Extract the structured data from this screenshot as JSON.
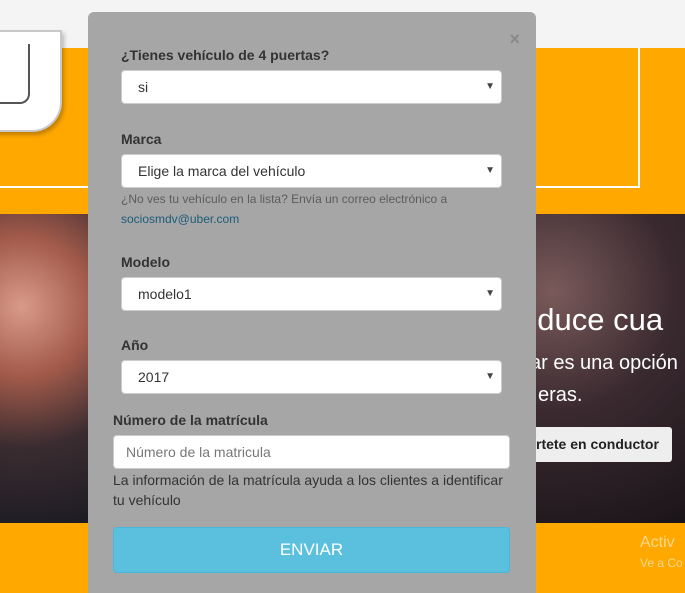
{
  "background": {
    "hero_heading": "nduce cua",
    "hero_line1": "ar es una opción",
    "hero_line2": "eras.",
    "hero_button": "rtete en conductor",
    "watermark_line1": "Activ",
    "watermark_line2": "Ve a Co"
  },
  "modal": {
    "close_label": "×",
    "doors": {
      "label": "¿Tienes vehículo de 4 puertas?",
      "value": "si"
    },
    "brand": {
      "label": "Marca",
      "value": "Elige la marca del vehículo",
      "help_text": "¿No ves tu vehículo en la lista? Envía un correo electrónico a",
      "help_email": "sociosmdv@uber.com"
    },
    "model": {
      "label": "Modelo",
      "value": "modelo1"
    },
    "year": {
      "label": "Año",
      "value": "2017"
    },
    "plate": {
      "label": "Número de la matrícula",
      "placeholder": "Número de la matricula",
      "info": "La información de la matrícula ayuda a los clientes a identificar tu vehículo"
    },
    "submit_label": "ENVIAR"
  }
}
